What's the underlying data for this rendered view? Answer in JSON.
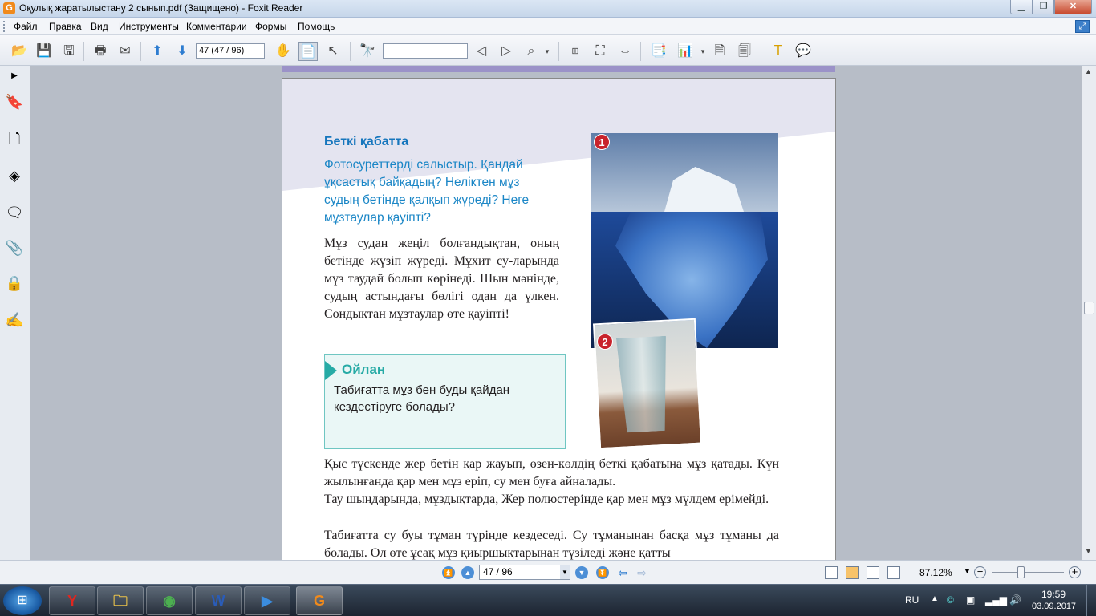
{
  "window": {
    "title": "Оқулық жаратылыстану 2 сынып.pdf (Защищено) - Foxit Reader",
    "app_icon_glyph": "G",
    "min_label": "▁",
    "max_label": "❐",
    "close_label": "✕"
  },
  "menu": {
    "items": [
      "Файл",
      "Правка",
      "Вид",
      "Инструменты",
      "Комментарии",
      "Формы",
      "Помощь"
    ]
  },
  "toolbar": {
    "page_field_value": "47 (47 / 96)",
    "search_value": ""
  },
  "document": {
    "section_heading": "Беткі қабатта",
    "question": "Фотосуреттерді салыстыр. Қандай ұқсастық байқадың? Неліктен мұз судың бетінде қалқып жүреді? Неге мұзтаулар қауіпті?",
    "paragraph_1": "Мұз судан жеңіл болғандықтан, оның бетінде жүзіп жүреді. Мұхит су-ларында мұз таудай болып көрінеді. Шын мәнінде, судың астындағы бөлігі одан да үлкен. Сондықтан мұзтаулар өте қауіпті!",
    "think_title": "Ойлан",
    "think_text": "Табиғатта мұз бен буды қайдан кездестіруге болады?",
    "photo1_badge": "1",
    "photo2_badge": "2",
    "paragraph_2": "Қыс түскенде жер бетін қар жауып, өзен-көлдің беткі қабатына мұз қатады. Күн жылынғанда қар мен мұз еріп, су мен буға айналады.",
    "paragraph_3": "Тау шыңдарында, мұздықтарда, Жер полюстерінде қар мен мұз мүлдем ерімейді.",
    "paragraph_4": "Табиғатта су буы тұман түрінде кездеседі. Су тұманынан басқа мұз тұманы да болады. Ол өте ұсақ мұз қиыршықтарынан түзіледі және қатты"
  },
  "statusbar": {
    "page_select_value": "47 / 96",
    "zoom_value": "87.12%"
  },
  "taskbar": {
    "language": "RU",
    "time": "19:59",
    "date": "03.09.2017"
  },
  "colors": {
    "heading_blue": "#1676bd",
    "question_blue": "#1a86c6",
    "think_teal": "#27aba6",
    "badge_red": "#c8232c"
  }
}
